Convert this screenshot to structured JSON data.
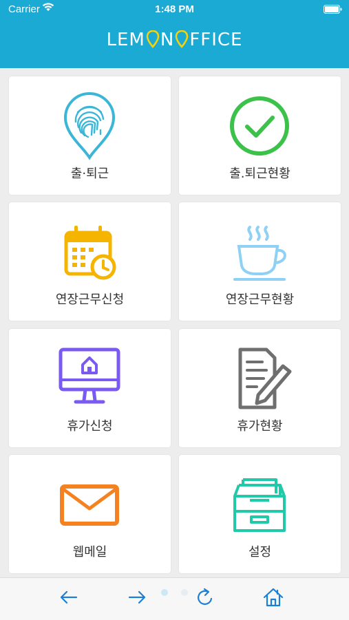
{
  "status_bar": {
    "carrier": "Carrier",
    "time": "1:48 PM"
  },
  "header": {
    "brand_left": "LEM",
    "brand_mid": "N ",
    "brand_right": "FFICE"
  },
  "menu": [
    {
      "label": "출·퇴근",
      "icon": "fingerprint-pin-icon",
      "color": "#3bb6d6"
    },
    {
      "label": "출.퇴근현황",
      "icon": "check-circle-icon",
      "color": "#3cc14a"
    },
    {
      "label": "연장근무신청",
      "icon": "calendar-clock-icon",
      "color": "#f5b400"
    },
    {
      "label": "연장근무현황",
      "icon": "coffee-cup-icon",
      "color": "#8fd0f5"
    },
    {
      "label": "휴가신청",
      "icon": "monitor-home-icon",
      "color": "#7a5af0"
    },
    {
      "label": "휴가현황",
      "icon": "document-edit-icon",
      "color": "#6f6f6f"
    },
    {
      "label": "웹메일",
      "icon": "mail-envelope-icon",
      "color": "#f58220"
    },
    {
      "label": "설정",
      "icon": "archive-drawer-icon",
      "color": "#20c9a8"
    }
  ],
  "toolbar": {
    "icons": [
      "arrow-left-icon",
      "arrow-right-icon",
      "refresh-icon",
      "home-icon"
    ],
    "accent": "#1a7fd6"
  },
  "colors": {
    "header_bg": "#1aaad4",
    "logo_accent": "#f5d20a"
  }
}
